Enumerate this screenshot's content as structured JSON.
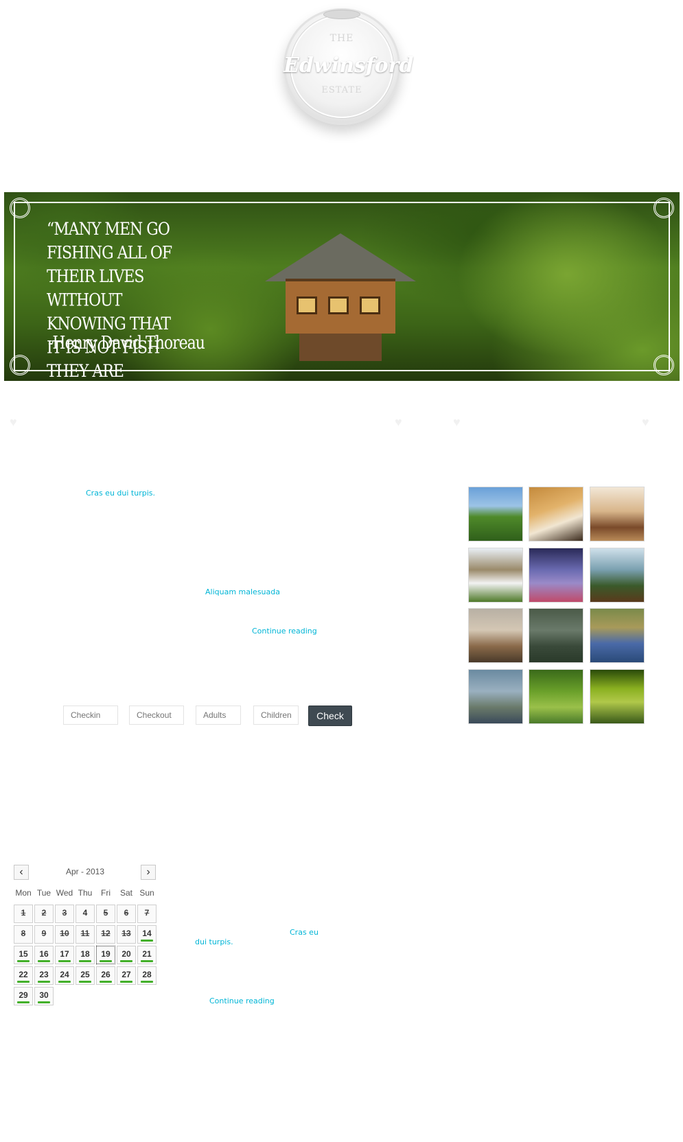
{
  "logo": {
    "line1": "THE",
    "line2": "Edwinsford",
    "line3": "ESTATE"
  },
  "banner": {
    "quote": "“Many men go fishing all of their lives without knowing that it is not fish they are after.”",
    "author": "-Henry David Thoreau"
  },
  "links": {
    "cras1": "Cras eu dui turpis.",
    "aliquam": "Aliquam malesuada",
    "continue1": "Continue reading",
    "cras2a": "Cras eu",
    "cras2b": "dui  turpis.",
    "continue2": "Continue reading"
  },
  "gallery": {
    "items": [
      {
        "name": "white-house"
      },
      {
        "name": "bedroom"
      },
      {
        "name": "living-room"
      },
      {
        "name": "thatched-cottage"
      },
      {
        "name": "house-at-night"
      },
      {
        "name": "eagle"
      },
      {
        "name": "wheatear-bird"
      },
      {
        "name": "river-angler"
      },
      {
        "name": "lake-angler"
      },
      {
        "name": "salmon-catch"
      },
      {
        "name": "child-fishing"
      },
      {
        "name": "woodland-walk"
      }
    ]
  },
  "booking": {
    "checkin_placeholder": "Checkin",
    "checkout_placeholder": "Checkout",
    "adults_placeholder": "Adults",
    "children_placeholder": "Children",
    "check_label": "Check"
  },
  "calendar": {
    "title": "Apr - 2013",
    "prev_icon": "chevron-left-icon",
    "next_icon": "chevron-right-icon",
    "weekdays": [
      "Mon",
      "Tue",
      "Wed",
      "Thu",
      "Fri",
      "Sat",
      "Sun"
    ],
    "days": [
      {
        "d": "1",
        "state": "past"
      },
      {
        "d": "2",
        "state": "past"
      },
      {
        "d": "3",
        "state": "past"
      },
      {
        "d": "4",
        "state": "none"
      },
      {
        "d": "5",
        "state": "past"
      },
      {
        "d": "6",
        "state": "past"
      },
      {
        "d": "7",
        "state": "past"
      },
      {
        "d": "8",
        "state": "past"
      },
      {
        "d": "9",
        "state": "past"
      },
      {
        "d": "10",
        "state": "past"
      },
      {
        "d": "11",
        "state": "past"
      },
      {
        "d": "12",
        "state": "past"
      },
      {
        "d": "13",
        "state": "past"
      },
      {
        "d": "14",
        "state": "available"
      },
      {
        "d": "15",
        "state": "available"
      },
      {
        "d": "16",
        "state": "available"
      },
      {
        "d": "17",
        "state": "available"
      },
      {
        "d": "18",
        "state": "available"
      },
      {
        "d": "19",
        "state": "today"
      },
      {
        "d": "20",
        "state": "available"
      },
      {
        "d": "21",
        "state": "available"
      },
      {
        "d": "22",
        "state": "available"
      },
      {
        "d": "23",
        "state": "available"
      },
      {
        "d": "24",
        "state": "available"
      },
      {
        "d": "25",
        "state": "available"
      },
      {
        "d": "26",
        "state": "available"
      },
      {
        "d": "27",
        "state": "available"
      },
      {
        "d": "28",
        "state": "available"
      },
      {
        "d": "29",
        "state": "available"
      },
      {
        "d": "30",
        "state": "available"
      }
    ],
    "available_color": "#43b02a"
  },
  "colors": {
    "link": "#00b5d6",
    "button": "#3f4a52"
  }
}
